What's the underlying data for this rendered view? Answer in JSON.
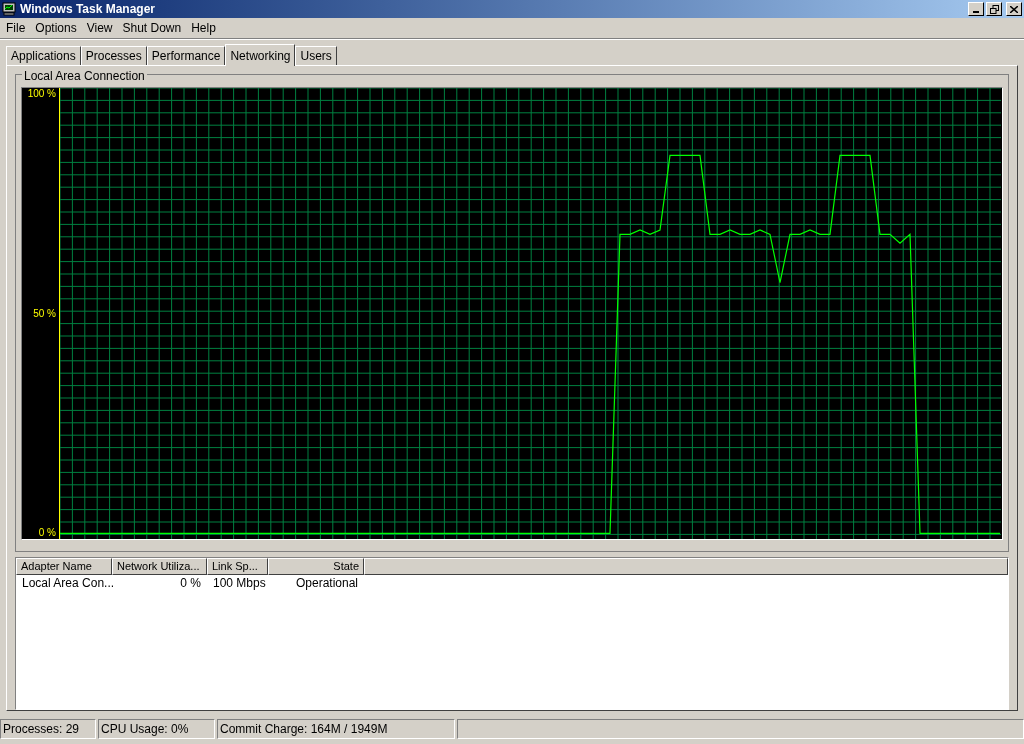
{
  "window": {
    "title": "Windows Task Manager"
  },
  "menu": [
    {
      "label": "File"
    },
    {
      "label": "Options"
    },
    {
      "label": "View"
    },
    {
      "label": "Shut Down"
    },
    {
      "label": "Help"
    }
  ],
  "tabs": [
    {
      "label": "Applications",
      "selected": false
    },
    {
      "label": "Processes",
      "selected": false
    },
    {
      "label": "Performance",
      "selected": false
    },
    {
      "label": "Networking",
      "selected": true
    },
    {
      "label": "Users",
      "selected": false
    }
  ],
  "graph": {
    "title": "Local Area Connection",
    "chart_data": {
      "type": "line",
      "grid": true,
      "ylim": [
        -1.3,
        101.3
      ],
      "yticks": [
        {
          "value": 0,
          "label": "0 %"
        },
        {
          "value": 50,
          "label": "50 %"
        },
        {
          "value": 100,
          "label": "100 %"
        }
      ],
      "series": [
        {
          "color": "#00ff00",
          "values": [
            0,
            0,
            0,
            0,
            0,
            0,
            0,
            0,
            0,
            0,
            0,
            0,
            0,
            0,
            0,
            0,
            0,
            0,
            0,
            0,
            0,
            0,
            0,
            0,
            0,
            0,
            0,
            0,
            0,
            0,
            0,
            0,
            0,
            0,
            0,
            0,
            0,
            0,
            0,
            0,
            0,
            0,
            0,
            0,
            0,
            0,
            0,
            0,
            0,
            0,
            0,
            0,
            0,
            0,
            0,
            0,
            68,
            68,
            69,
            68,
            69,
            86,
            86,
            86,
            86,
            68,
            68,
            69,
            68,
            68,
            69,
            68,
            57,
            68,
            68,
            69,
            68,
            68,
            86,
            86,
            86,
            86,
            68,
            68,
            66,
            68,
            0,
            0,
            0,
            0,
            0,
            0,
            0,
            0,
            0
          ]
        }
      ]
    }
  },
  "table": {
    "columns": [
      {
        "label": "Adapter Name"
      },
      {
        "label": "Network Utiliza..."
      },
      {
        "label": "Link Sp..."
      },
      {
        "label": "State"
      }
    ],
    "rows": [
      [
        "Local Area Con...",
        "0 %",
        "100 Mbps",
        "Operational"
      ]
    ]
  },
  "status_bar": [
    "Processes: 29",
    "CPU Usage: 0%",
    "Commit Charge: 164M / 1949M"
  ]
}
